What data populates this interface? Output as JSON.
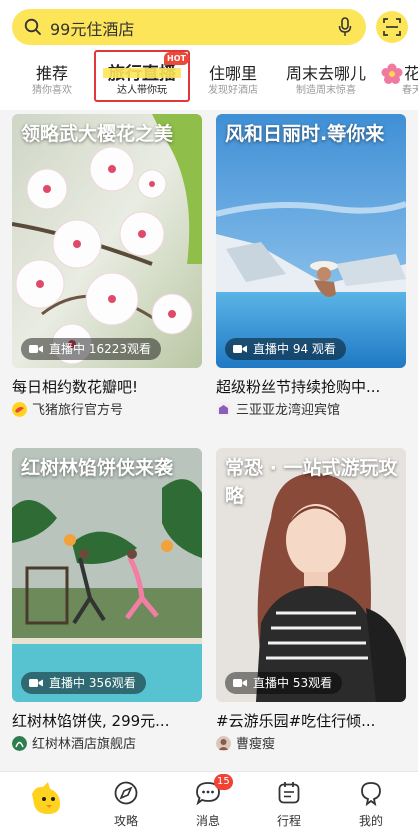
{
  "search": {
    "placeholder": "99元住酒店"
  },
  "tabs": [
    {
      "title": "推荐",
      "sub": "猜你喜欢"
    },
    {
      "title": "旅行直播",
      "sub": "达人带你玩",
      "badge": "HOT"
    },
    {
      "title": "住哪里",
      "sub": "发现好酒店"
    },
    {
      "title": "周末去哪儿",
      "sub": "制造周末惊喜"
    },
    {
      "title": "花",
      "sub": "春天"
    }
  ],
  "cards": [
    {
      "image_title": "领略武大樱花之美",
      "live": "直播中 16223观看",
      "title": "每日相约数花瓣吧!",
      "author": "飞猪旅行官方号"
    },
    {
      "image_title": "风和日丽时.等你来",
      "live": "直播中 94 观看",
      "title": "超级粉丝节持续抢购中...",
      "author": "三亚亚龙湾迎宾馆"
    },
    {
      "image_title": "红树林馅饼侠来袭",
      "live": "直播中 356观看",
      "title": "红树林馅饼侠, 299元...",
      "author": "红树林酒店旗舰店"
    },
    {
      "image_title": "常恐 · 一站式游玩攻略",
      "live": "直播中 53观看",
      "title": "#云游乐园#吃住行倾...",
      "author": "曹瘦瘦"
    }
  ],
  "bottom_nav": [
    {
      "label": "",
      "icon": "fliggy-logo-icon"
    },
    {
      "label": "攻略",
      "icon": "compass-icon"
    },
    {
      "label": "消息",
      "icon": "message-icon",
      "badge": "15"
    },
    {
      "label": "行程",
      "icon": "itinerary-icon"
    },
    {
      "label": "我的",
      "icon": "profile-icon"
    }
  ],
  "colors": {
    "accent_yellow": "#fde55a",
    "highlight_red": "#e0383a",
    "badge_red": "#f24236"
  }
}
